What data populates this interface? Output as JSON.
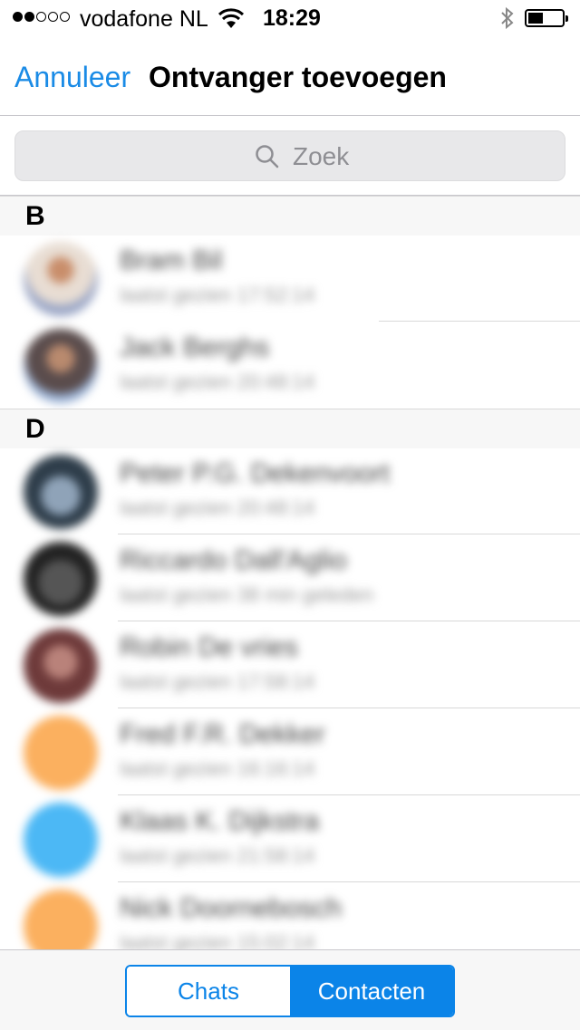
{
  "status_bar": {
    "carrier": "vodafone NL",
    "time": "18:29",
    "signal_strength": 2,
    "battery_level": 0.4,
    "icons": [
      "wifi-icon",
      "bluetooth-icon",
      "battery-icon"
    ]
  },
  "nav": {
    "cancel_label": "Annuleer",
    "title": "Ontvanger toevoegen"
  },
  "search": {
    "placeholder": "Zoek"
  },
  "sections": [
    {
      "letter": "B",
      "contacts": [
        {
          "name": "Bram Bil",
          "subtitle": "laatst gezien 17:52:14"
        },
        {
          "name": "Jack Berghs",
          "subtitle": "laatst gezien 20:48:14"
        }
      ]
    },
    {
      "letter": "D",
      "contacts": [
        {
          "name": "Peter P.G. Dekenvoort",
          "subtitle": "laatst gezien 20:48:14"
        },
        {
          "name": "Riccardo Dall'Aglio",
          "subtitle": "laatst gezien 38 min geleden"
        },
        {
          "name": "Robin De vries",
          "subtitle": "laatst gezien 17:58:14"
        },
        {
          "name": "Fred F.R. Dekker",
          "subtitle": "laatst gezien 16:16:14"
        },
        {
          "name": "Klaas K. Dijkstra",
          "subtitle": "laatst gezien 21:58:14"
        },
        {
          "name": "Nick Doornebosch",
          "subtitle": "laatst gezien 15:02:14"
        }
      ]
    }
  ],
  "tabs": {
    "chats_label": "Chats",
    "contacts_label": "Contacten",
    "selected": "Contacten"
  },
  "colors": {
    "accent": "#0b84e8",
    "avatar_orange": "#fbb05f",
    "avatar_blue": "#4cb8f5"
  }
}
